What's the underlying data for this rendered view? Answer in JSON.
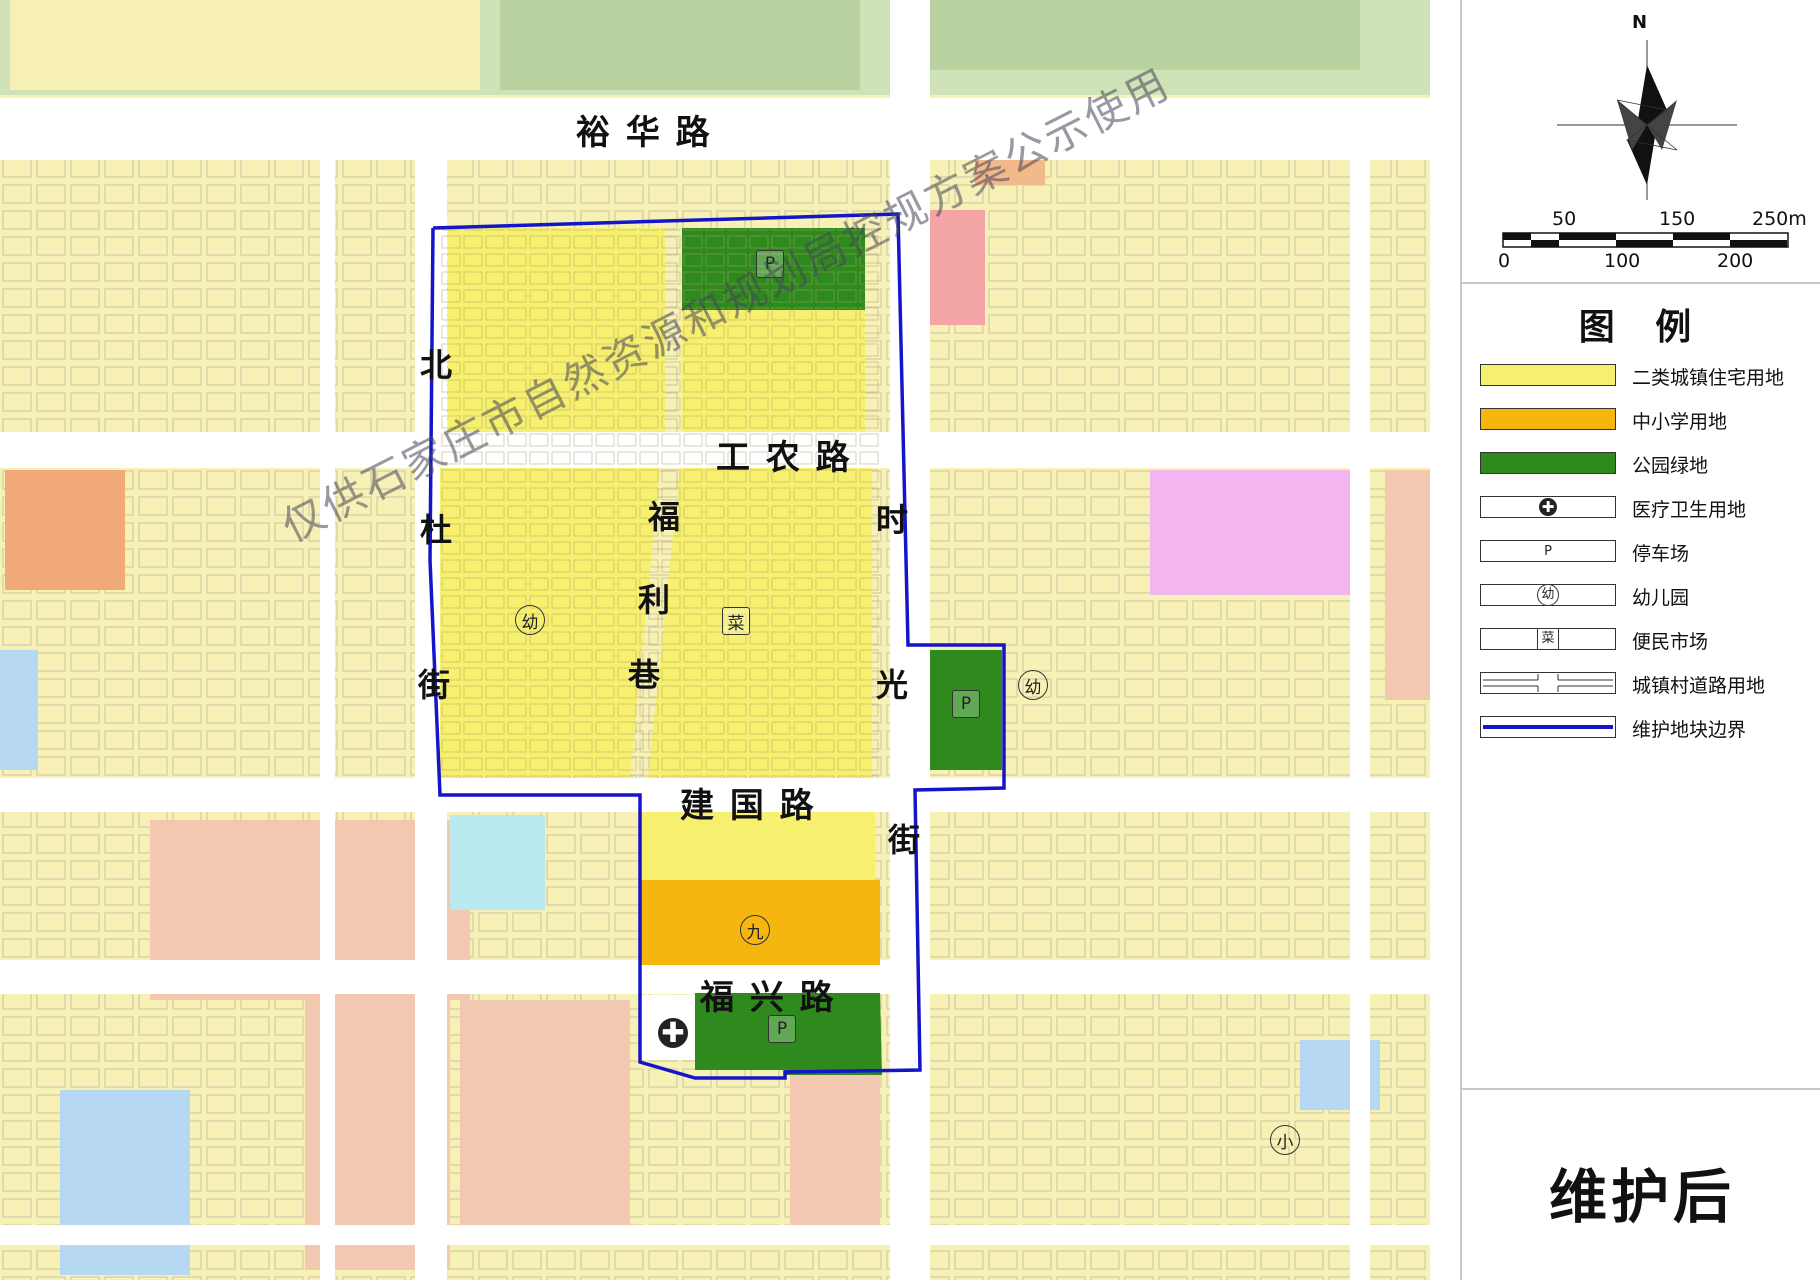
{
  "map": {
    "roads": {
      "yuhua": "裕 华 路",
      "gongnong": "工 农 路",
      "jianguo": "建 国 路",
      "fuxing": "福 兴 路",
      "dubei_chars": [
        "北",
        "杜",
        "街"
      ],
      "fuli_chars": [
        "福",
        "利",
        "巷"
      ],
      "shiguang_chars": [
        "时",
        "光",
        "街"
      ]
    },
    "markers": {
      "parking": "P",
      "kindergarten": "幼",
      "market": "菜",
      "school": "九",
      "primary_school": "小",
      "hospital": "✚"
    },
    "watermark": "仅供石家庄市自然资源和规划局控规方案公示使用",
    "colors": {
      "residential": "#f7f06e",
      "residential_bg": "#f7f1b5",
      "school": "#f5b60f",
      "park": "#2e8a1c",
      "park_bg": "#cfe2b8",
      "boundary": "#1414c8",
      "commercial": "#f3a5a5",
      "admin": "#f3b5f0",
      "public": "#f2c9b0",
      "water": "#b7d8f2",
      "road": "#ffffff"
    }
  },
  "legend": {
    "compass_n": "N",
    "scale_top": [
      "50",
      "150",
      "250m"
    ],
    "scale_bottom": [
      "0",
      "100",
      "200"
    ],
    "title": "图 例",
    "items": [
      {
        "label": "二类城镇住宅用地",
        "swatch": "residential"
      },
      {
        "label": "中小学用地",
        "swatch": "school"
      },
      {
        "label": "公园绿地",
        "swatch": "park"
      },
      {
        "label": "医疗卫生用地",
        "swatch": "hospital",
        "symbol": "✚"
      },
      {
        "label": "停车场",
        "swatch": "parking",
        "symbol": "P"
      },
      {
        "label": "幼儿园",
        "swatch": "kindergarten",
        "symbol": "幼"
      },
      {
        "label": "便民市场",
        "swatch": "market",
        "symbol": "菜"
      },
      {
        "label": "城镇村道路用地",
        "swatch": "road"
      },
      {
        "label": "维护地块边界",
        "swatch": "boundary"
      }
    ],
    "status": "维护后"
  }
}
